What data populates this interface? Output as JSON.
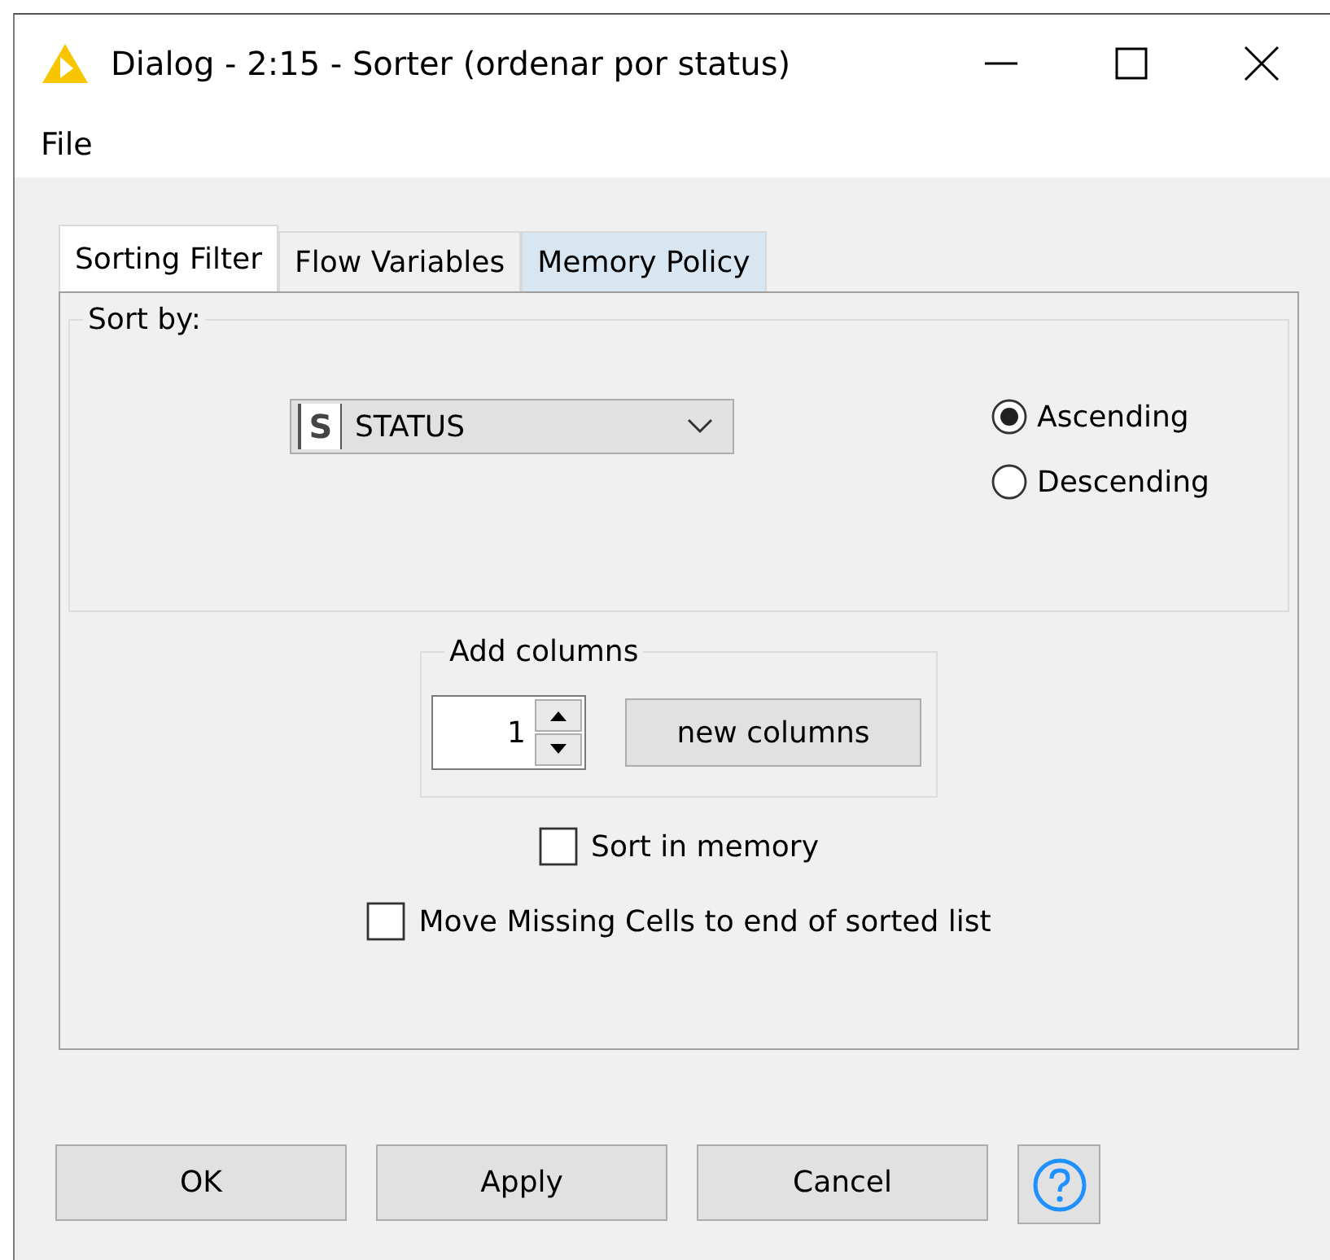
{
  "window": {
    "title": "Dialog - 2:15 - Sorter (ordenar por status)"
  },
  "menu": [
    "File"
  ],
  "tabs": [
    {
      "label": "Sorting Filter",
      "selected": true,
      "hovered": false
    },
    {
      "label": "Flow Variables",
      "selected": false,
      "hovered": false
    },
    {
      "label": "Memory Policy",
      "selected": false,
      "hovered": true
    }
  ],
  "sort_by": {
    "legend": "Sort by:",
    "column": {
      "type_icon": "S",
      "value": "STATUS"
    },
    "order": [
      {
        "label": "Ascending",
        "selected": true
      },
      {
        "label": "Descending",
        "selected": false
      }
    ]
  },
  "add_columns": {
    "legend": "Add columns",
    "count": "1",
    "button": "new columns"
  },
  "options": [
    {
      "label": "Sort in memory",
      "checked": false
    },
    {
      "label": "Move Missing Cells to end of sorted list",
      "checked": false
    }
  ],
  "buttons": [
    "OK",
    "Apply",
    "Cancel"
  ]
}
